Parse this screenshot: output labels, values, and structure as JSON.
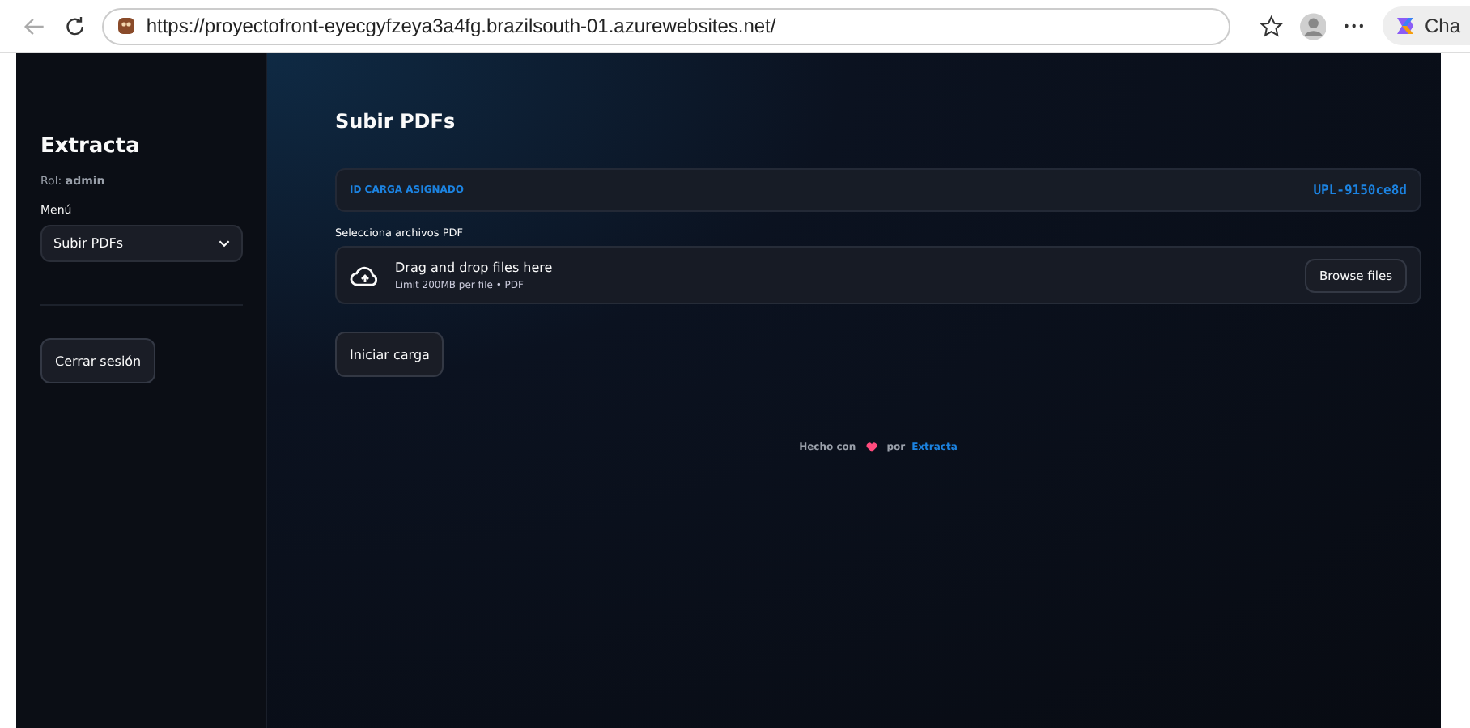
{
  "browser": {
    "url": "https://proyectofront-eyecgyfzeya3a4fg.brazilsouth-01.azurewebsites.net/",
    "copilot_label": "Cha"
  },
  "sidebar": {
    "title": "Extracta",
    "role_label": "Rol:",
    "role": "admin",
    "menu_label": "Menú",
    "menu_value": "Subir PDFs",
    "logout": "Cerrar sesión"
  },
  "main": {
    "title": "Subir PDFs",
    "id_label": "ID CARGA ASIGNADO",
    "id_value": "UPL-9150ce8d",
    "file_label": "Selecciona archivos PDF",
    "drop_title": "Drag and drop files here",
    "drop_hint": "Limit 200MB per file • PDF",
    "browse": "Browse files",
    "start": "Iniciar carga"
  },
  "footer": {
    "before": "Hecho con",
    "after": "por",
    "link": "Extracta"
  }
}
